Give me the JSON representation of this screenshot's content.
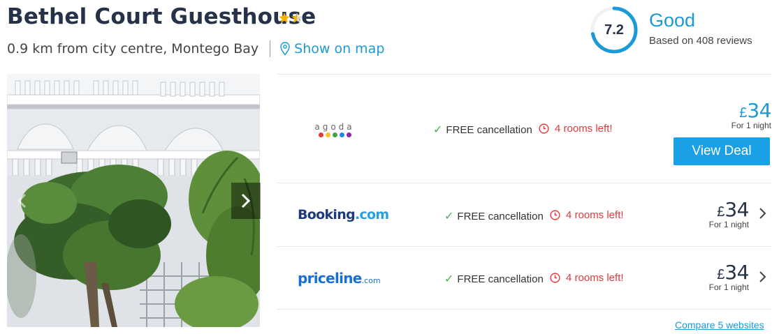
{
  "hotel": {
    "name": "Bethel Court Guesthouse",
    "star_rating": 2.5,
    "distance": "0.9 km from city centre, Montego Bay",
    "map_link": "Show on map"
  },
  "rating": {
    "score": "7.2",
    "score_fraction": 0.72,
    "word": "Good",
    "reviews": "Based on 408 reviews"
  },
  "photo": {
    "icons": {
      "next": "chevron-right-icon",
      "prev": "chevron-left-icon"
    }
  },
  "deals": [
    {
      "provider": "agoda",
      "provider_letters": "agoda",
      "cancellation": "FREE cancellation",
      "rooms_left": "4 rooms left!",
      "currency": "£",
      "price": "34",
      "per": "For 1 night",
      "button": "View Deal"
    },
    {
      "provider": "Booking.com",
      "provider_main": "Booking",
      "provider_suffix": ".com",
      "cancellation": "FREE cancellation",
      "rooms_left": "4 rooms left!",
      "currency": "£",
      "price": "34",
      "per": "For 1 night"
    },
    {
      "provider": "priceline.com",
      "provider_main": "priceline",
      "provider_suffix": ".com",
      "cancellation": "FREE cancellation",
      "rooms_left": "4 rooms left!",
      "currency": "£",
      "price": "34",
      "per": "For 1 night"
    }
  ],
  "compare_link": "Compare 5 websites",
  "colors": {
    "accent": "#1a9ad6",
    "button": "#19a0e6",
    "warning": "#e0393e",
    "tick": "#4caf50",
    "star": "#f2b400",
    "title": "#253248"
  }
}
